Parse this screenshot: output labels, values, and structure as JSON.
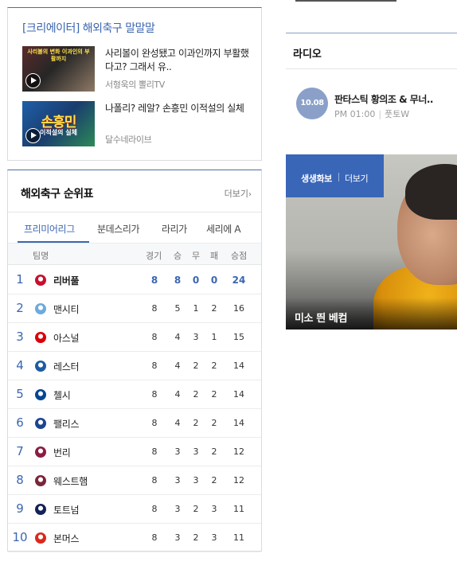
{
  "creator": {
    "title": "[크리에이터] 해외축구 말말말",
    "videos": [
      {
        "title": "사리볼이 완성됐고 이과인까지 부활했다고? 그래서 유..",
        "source": "서형욱의 뽈리TV",
        "thumb_caption": "사리볼의 변화 이과인의 부활까지",
        "thumb_big": "",
        "thumb_sub": ""
      },
      {
        "title": "나폴리? 레알? 손흥민 이적설의 실체",
        "source": "달수네라이브",
        "thumb_caption": "",
        "thumb_big": "손흥민",
        "thumb_sub": "이적설의 실체"
      }
    ]
  },
  "standings": {
    "title": "해외축구 순위표",
    "more": "더보기",
    "tabs": [
      "프리미어리그",
      "분데스리가",
      "라리가",
      "세리에 A"
    ],
    "active_tab": 0,
    "headers": {
      "team": "팀명",
      "played": "경기",
      "won": "승",
      "drawn": "무",
      "lost": "패",
      "points": "승점"
    },
    "rows": [
      {
        "rank": "1",
        "team": "리버풀",
        "played": "8",
        "won": "8",
        "drawn": "0",
        "lost": "0",
        "points": "24",
        "crest_color": "#c8102e"
      },
      {
        "rank": "2",
        "team": "맨시티",
        "played": "8",
        "won": "5",
        "drawn": "1",
        "lost": "2",
        "points": "16",
        "crest_color": "#6cabdd"
      },
      {
        "rank": "3",
        "team": "아스널",
        "played": "8",
        "won": "4",
        "drawn": "3",
        "lost": "1",
        "points": "15",
        "crest_color": "#db0007"
      },
      {
        "rank": "4",
        "team": "레스터",
        "played": "8",
        "won": "4",
        "drawn": "2",
        "lost": "2",
        "points": "14",
        "crest_color": "#1d5ba4"
      },
      {
        "rank": "5",
        "team": "첼시",
        "played": "8",
        "won": "4",
        "drawn": "2",
        "lost": "2",
        "points": "14",
        "crest_color": "#034694"
      },
      {
        "rank": "6",
        "team": "팰리스",
        "played": "8",
        "won": "4",
        "drawn": "2",
        "lost": "2",
        "points": "14",
        "crest_color": "#1b458f"
      },
      {
        "rank": "7",
        "team": "번리",
        "played": "8",
        "won": "3",
        "drawn": "3",
        "lost": "2",
        "points": "12",
        "crest_color": "#8c1d40"
      },
      {
        "rank": "8",
        "team": "웨스트햄",
        "played": "8",
        "won": "3",
        "drawn": "3",
        "lost": "2",
        "points": "12",
        "crest_color": "#7a263a"
      },
      {
        "rank": "9",
        "team": "토트넘",
        "played": "8",
        "won": "3",
        "drawn": "2",
        "lost": "3",
        "points": "11",
        "crest_color": "#132257"
      },
      {
        "rank": "10",
        "team": "본머스",
        "played": "8",
        "won": "3",
        "drawn": "2",
        "lost": "3",
        "points": "11",
        "crest_color": "#da291c"
      }
    ]
  },
  "radio": {
    "title": "라디오",
    "badge": "10.08",
    "show": "판타스틱 황의조 & 무너..",
    "time": "PM 01:00",
    "channel": "풋토W"
  },
  "photo": {
    "tab_label": "생생화보",
    "tab_more": "더보기",
    "caption": "미소 띈 베컴"
  },
  "colors": {
    "accent": "#3b66b1",
    "photo_tab": "#3a66b8",
    "radio_badge": "#8aa0c8"
  }
}
